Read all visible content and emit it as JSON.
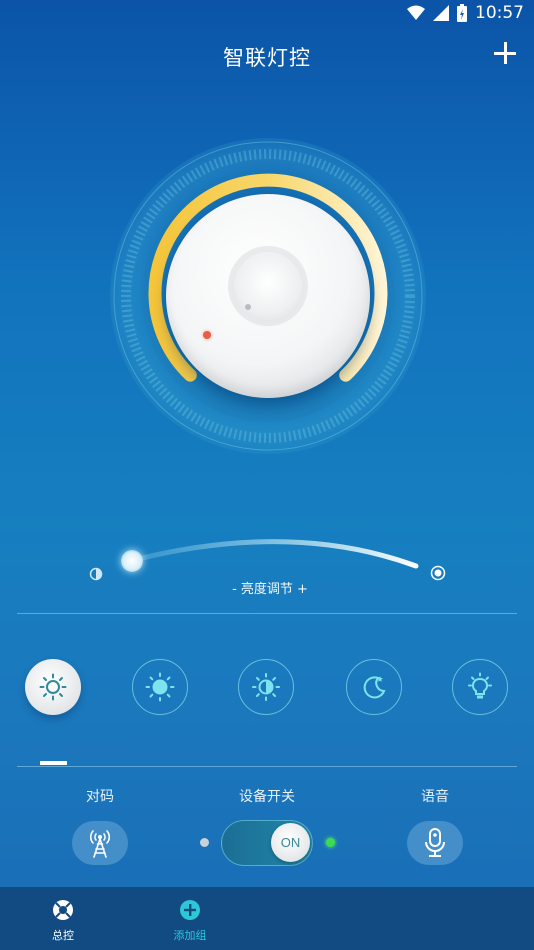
{
  "status_bar": {
    "time": "10:57"
  },
  "header": {
    "title": "智联灯控"
  },
  "brightness": {
    "label": "- 亮度调节 +",
    "level_fraction": 0.03
  },
  "color_dial": {
    "warm_color": "#f5c53a",
    "cool_color": "#fff6d8"
  },
  "modes": [
    {
      "icon": "sun-outline-icon",
      "selected": true
    },
    {
      "icon": "sun-filled-icon",
      "selected": false
    },
    {
      "icon": "half-sun-icon",
      "selected": false
    },
    {
      "icon": "moon-icon",
      "selected": false
    },
    {
      "icon": "bulb-icon",
      "selected": false
    }
  ],
  "controls": {
    "pair_label": "对码",
    "power_label": "设备开关",
    "voice_label": "语音",
    "toggle_text": "ON",
    "toggle_on": true
  },
  "bottom_nav": {
    "items": [
      {
        "label": "总控",
        "icon": "master-control-icon",
        "active": true
      },
      {
        "label": "添加组",
        "icon": "add-group-icon",
        "active": false
      }
    ]
  },
  "colors": {
    "accent_green": "#3ddc4e",
    "nav_bg": "#124a82"
  }
}
